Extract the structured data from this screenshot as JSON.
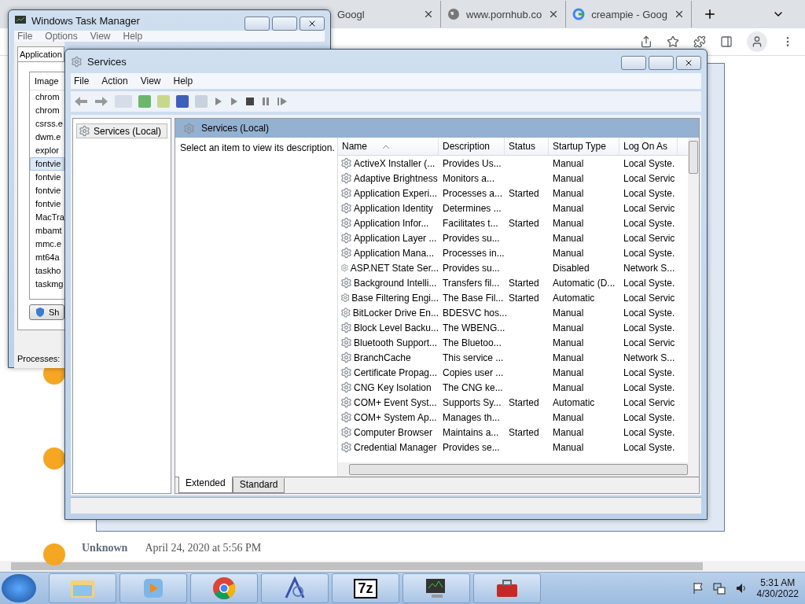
{
  "browser": {
    "tabs": [
      {
        "title": "Googl",
        "kind": "plain",
        "selected": false
      },
      {
        "title": "www.pornhub.co",
        "kind": "globe",
        "selected": false
      },
      {
        "title": "creampie - Goog",
        "kind": "google",
        "selected": false
      }
    ],
    "comment": {
      "author": "Unknown",
      "date": "April 24, 2020 at 5:56 PM"
    }
  },
  "task_manager": {
    "title": "Windows Task Manager",
    "menu": [
      "File",
      "Options",
      "View",
      "Help"
    ],
    "tab": "Application",
    "column": "Image",
    "processes": [
      {
        "name": "chrom",
        "selected": false
      },
      {
        "name": "chrom",
        "selected": false
      },
      {
        "name": "csrss.e",
        "selected": false
      },
      {
        "name": "dwm.e",
        "selected": false
      },
      {
        "name": "explor",
        "selected": false
      },
      {
        "name": "fontvie",
        "selected": true
      },
      {
        "name": "fontvie",
        "selected": false
      },
      {
        "name": "fontvie",
        "selected": false
      },
      {
        "name": "fontvie",
        "selected": false
      },
      {
        "name": "MacTra",
        "selected": false
      },
      {
        "name": "mbamt",
        "selected": false
      },
      {
        "name": "mmc.e",
        "selected": false
      },
      {
        "name": "mt64a",
        "selected": false
      },
      {
        "name": "taskho",
        "selected": false
      },
      {
        "name": "taskmg",
        "selected": false
      }
    ],
    "button": "Sh",
    "status": "Processes:"
  },
  "services": {
    "title": "Services",
    "menu": [
      "File",
      "Action",
      "View",
      "Help"
    ],
    "tree": [
      {
        "label": "Services (Local)",
        "selected": true
      }
    ],
    "header": "Services (Local)",
    "hint": "Select an item to view its description.",
    "columns": [
      "Name",
      "Description",
      "Status",
      "Startup Type",
      "Log On As"
    ],
    "rows": [
      {
        "name": "ActiveX Installer (...",
        "description": "Provides Us...",
        "startup": "Manual",
        "logon": "Local Syste."
      },
      {
        "name": "Adaptive Brightness",
        "description": "Monitors a...",
        "startup": "Manual",
        "logon": "Local Servic"
      },
      {
        "name": "Application Experi...",
        "description": "Processes a...",
        "status": "Started",
        "startup": "Manual",
        "logon": "Local Syste."
      },
      {
        "name": "Application Identity",
        "description": "Determines ...",
        "startup": "Manual",
        "logon": "Local Servic"
      },
      {
        "name": "Application Infor...",
        "description": "Facilitates t...",
        "status": "Started",
        "startup": "Manual",
        "logon": "Local Syste."
      },
      {
        "name": "Application Layer ...",
        "description": "Provides su...",
        "startup": "Manual",
        "logon": "Local Servic"
      },
      {
        "name": "Application Mana...",
        "description": "Processes in...",
        "startup": "Manual",
        "logon": "Local Syste."
      },
      {
        "name": "ASP.NET State Ser...",
        "description": "Provides su...",
        "startup": "Disabled",
        "logon": "Network S..."
      },
      {
        "name": "Background Intelli...",
        "description": "Transfers fil...",
        "status": "Started",
        "startup": "Automatic (D...",
        "logon": "Local Syste."
      },
      {
        "name": "Base Filtering Engi...",
        "description": "The Base Fil...",
        "status": "Started",
        "startup": "Automatic",
        "logon": "Local Servic"
      },
      {
        "name": "BitLocker Drive En...",
        "description": "BDESVC hos...",
        "startup": "Manual",
        "logon": "Local Syste."
      },
      {
        "name": "Block Level Backu...",
        "description": "The WBENG...",
        "startup": "Manual",
        "logon": "Local Syste."
      },
      {
        "name": "Bluetooth Support...",
        "description": "The Bluetoo...",
        "startup": "Manual",
        "logon": "Local Servic"
      },
      {
        "name": "BranchCache",
        "description": "This service ...",
        "startup": "Manual",
        "logon": "Network S..."
      },
      {
        "name": "Certificate Propag...",
        "description": "Copies user ...",
        "startup": "Manual",
        "logon": "Local Syste."
      },
      {
        "name": "CNG Key Isolation",
        "description": "The CNG ke...",
        "startup": "Manual",
        "logon": "Local Syste."
      },
      {
        "name": "COM+ Event Syst...",
        "description": "Supports Sy...",
        "status": "Started",
        "startup": "Automatic",
        "logon": "Local Servic"
      },
      {
        "name": "COM+ System Ap...",
        "description": "Manages th...",
        "startup": "Manual",
        "logon": "Local Syste."
      },
      {
        "name": "Computer Browser",
        "description": "Maintains a...",
        "status": "Started",
        "startup": "Manual",
        "logon": "Local Syste."
      },
      {
        "name": "Credential Manager",
        "description": "Provides se...",
        "startup": "Manual",
        "logon": "Local Syste."
      }
    ],
    "tabs": [
      {
        "label": "Extended",
        "selected": true
      },
      {
        "label": "Standard",
        "selected": false
      }
    ]
  },
  "taskbar": {
    "apps": [
      {
        "kind": "folder"
      },
      {
        "kind": "media"
      },
      {
        "kind": "chrome"
      },
      {
        "kind": "font"
      },
      {
        "kind": "archive",
        "label": "7z"
      },
      {
        "kind": "monitor"
      },
      {
        "kind": "toolbox"
      }
    ],
    "time": "5:31 AM",
    "date": "4/30/2022"
  }
}
